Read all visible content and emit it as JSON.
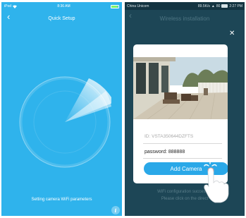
{
  "left": {
    "status": {
      "carrier": "iPod",
      "time": "8:36 AM",
      "battery_level": 0.9
    },
    "back_icon": "chevron-left-icon",
    "title": "Quick Setup",
    "caption": "Setting camera WiFi parameters",
    "info_icon": "info-icon",
    "colors": {
      "background": "#2fb3ec",
      "text": "#ffffff"
    }
  },
  "right": {
    "status": {
      "carrier": "China Unicom",
      "speed": "89.5K/s",
      "battery": "80",
      "time": "2:27 PM"
    },
    "back_icon": "chevron-left-icon",
    "title": "Wireless installation",
    "close_icon": "close-icon",
    "card": {
      "id_label": "ID: VSTA350644DZFTS",
      "password_label": "password: 888888",
      "button_label": "Add Camera"
    },
    "caption_line1": "WiFi configuration successful",
    "caption_line2": "Please click on the direct",
    "colors": {
      "background": "#1d4656",
      "button": "#2aa8e8"
    }
  }
}
